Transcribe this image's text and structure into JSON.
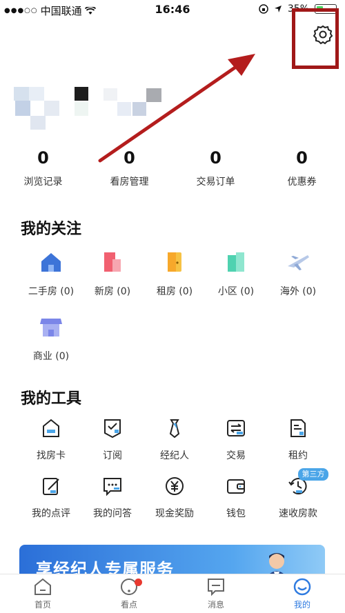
{
  "status_bar": {
    "carrier": "中国联通",
    "time": "16:46",
    "battery": "35%",
    "battery_level": 0.35
  },
  "stats": [
    {
      "value": "0",
      "label": "浏览记录"
    },
    {
      "value": "0",
      "label": "看房管理"
    },
    {
      "value": "0",
      "label": "交易订单"
    },
    {
      "value": "0",
      "label": "优惠券"
    }
  ],
  "follow": {
    "title": "我的关注",
    "items": [
      {
        "label": "二手房 (0)",
        "icon": "house-icon"
      },
      {
        "label": "新房 (0)",
        "icon": "building-icon"
      },
      {
        "label": "租房 (0)",
        "icon": "door-icon"
      },
      {
        "label": "小区 (0)",
        "icon": "community-icon"
      },
      {
        "label": "海外 (0)",
        "icon": "plane-icon"
      },
      {
        "label": "商业 (0)",
        "icon": "shop-icon"
      }
    ]
  },
  "tools": {
    "title": "我的工具",
    "items": [
      {
        "label": "找房卡",
        "icon": "house-card-icon"
      },
      {
        "label": "订阅",
        "icon": "subscribe-icon"
      },
      {
        "label": "经纪人",
        "icon": "tie-icon"
      },
      {
        "label": "交易",
        "icon": "exchange-icon"
      },
      {
        "label": "租约",
        "icon": "lease-icon"
      },
      {
        "label": "我的点评",
        "icon": "review-icon"
      },
      {
        "label": "我的问答",
        "icon": "qa-icon"
      },
      {
        "label": "现金奖励",
        "icon": "cash-icon"
      },
      {
        "label": "钱包",
        "icon": "wallet-icon"
      },
      {
        "label": "速收房款",
        "icon": "clock-icon"
      }
    ],
    "badge": "第三方"
  },
  "banner": {
    "text": "享经纪人专属服务"
  },
  "tabs": [
    {
      "label": "首页",
      "icon": "home-icon"
    },
    {
      "label": "看点",
      "icon": "discover-icon"
    },
    {
      "label": "消息",
      "icon": "message-icon"
    },
    {
      "label": "我的",
      "icon": "profile-icon"
    }
  ],
  "colors": {
    "accent": "#2f7be0",
    "highlight": "#a01818",
    "badge": "#4aa5e8"
  }
}
